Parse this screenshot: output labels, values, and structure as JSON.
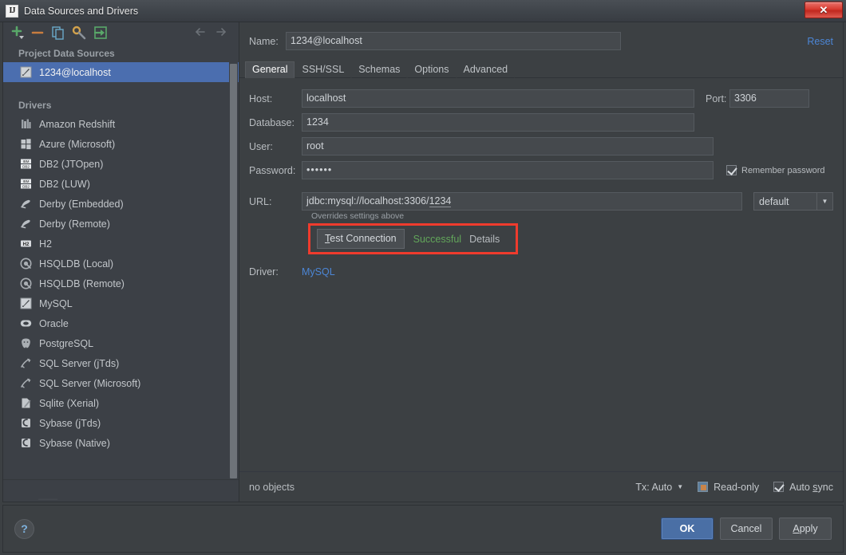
{
  "window": {
    "title": "Data Sources and Drivers",
    "app_icon": "IJ",
    "close_icon": "close-icon",
    "close_glyph": "✕"
  },
  "toolbar": {
    "items": [
      {
        "name": "add-data-source-button",
        "icon": "plus-icon",
        "title": "Add"
      },
      {
        "name": "remove-data-source-button",
        "icon": "minus-icon",
        "title": "Remove"
      },
      {
        "name": "duplicate-data-source-button",
        "icon": "copy-icon",
        "title": "Duplicate"
      },
      {
        "name": "driver-properties-button",
        "icon": "wrench-icon",
        "title": "Properties"
      },
      {
        "name": "import-data-source-button",
        "icon": "import-icon",
        "title": "Import"
      }
    ],
    "nav_back": "arrow-left-icon",
    "nav_forward": "arrow-right-icon"
  },
  "sidebar": {
    "project_group_label": "Project Data Sources",
    "data_sources": [
      {
        "label": "1234@localhost",
        "icon": "mysql-icon",
        "selected": true
      }
    ],
    "drivers_group_label": "Drivers",
    "drivers": [
      {
        "label": "Amazon Redshift",
        "icon": "redshift-icon"
      },
      {
        "label": "Azure (Microsoft)",
        "icon": "azure-icon"
      },
      {
        "label": "DB2 (JTOpen)",
        "icon": "db2-icon"
      },
      {
        "label": "DB2 (LUW)",
        "icon": "db2-icon"
      },
      {
        "label": "Derby (Embedded)",
        "icon": "derby-icon"
      },
      {
        "label": "Derby (Remote)",
        "icon": "derby-icon"
      },
      {
        "label": "H2",
        "icon": "h2-icon"
      },
      {
        "label": "HSQLDB (Local)",
        "icon": "hsqldb-icon"
      },
      {
        "label": "HSQLDB (Remote)",
        "icon": "hsqldb-icon"
      },
      {
        "label": "MySQL",
        "icon": "mysql-icon"
      },
      {
        "label": "Oracle",
        "icon": "oracle-icon"
      },
      {
        "label": "PostgreSQL",
        "icon": "postgresql-icon"
      },
      {
        "label": "SQL Server (jTds)",
        "icon": "sqlserver-icon"
      },
      {
        "label": "SQL Server (Microsoft)",
        "icon": "sqlserver-icon"
      },
      {
        "label": "Sqlite (Xerial)",
        "icon": "sqlite-icon"
      },
      {
        "label": "Sybase (jTds)",
        "icon": "sybase-icon"
      },
      {
        "label": "Sybase (Native)",
        "icon": "sybase-icon"
      }
    ]
  },
  "form": {
    "name_label": "Name:",
    "name_value": "1234@localhost",
    "reset_label": "Reset",
    "tabs": [
      {
        "label": "General",
        "active": true
      },
      {
        "label": "SSH/SSL",
        "active": false
      },
      {
        "label": "Schemas",
        "active": false
      },
      {
        "label": "Options",
        "active": false
      },
      {
        "label": "Advanced",
        "active": false
      }
    ],
    "host_label": "Host:",
    "host_value": "localhost",
    "port_label": "Port:",
    "port_value": "3306",
    "database_label": "Database:",
    "database_value": "1234",
    "user_label": "User:",
    "user_value": "root",
    "password_label": "Password:",
    "password_value": "••••••",
    "remember_password_label": "Remember password",
    "remember_password_checked": true,
    "url_label": "URL:",
    "url_value": "jdbc:mysql://localhost:3306/",
    "url_value_underlined": "1234",
    "url_combo_value": "default",
    "url_combo_arrow": "▼",
    "overrides_note": "Overrides settings above",
    "test_connection_label": "Test Connection",
    "test_connection_mnemonic": "T",
    "test_status": "Successful",
    "details_label": "Details",
    "driver_label": "Driver:",
    "driver_value": "MySQL"
  },
  "status_bar": {
    "objects_text": "no objects",
    "tx_label": "Tx: Auto",
    "tx_caret": "▼",
    "readonly_label": "Read-only",
    "readonly_checked": false,
    "autosync_label": "Auto sync",
    "autosync_mnemonic": "s",
    "autosync_checked": true
  },
  "footer": {
    "help_label": "?",
    "ok_label": "OK",
    "cancel_label": "Cancel",
    "apply_label": "Apply"
  },
  "colors": {
    "background": "#3c4043",
    "panel": "#3c4046",
    "selection_blue": "#4b6eaf",
    "link_blue": "#4c86d6",
    "success_green": "#62a65a",
    "highlight_red": "#ef3b2d",
    "primary_button": "#4a6fa5",
    "close_red": "#d93a30"
  }
}
